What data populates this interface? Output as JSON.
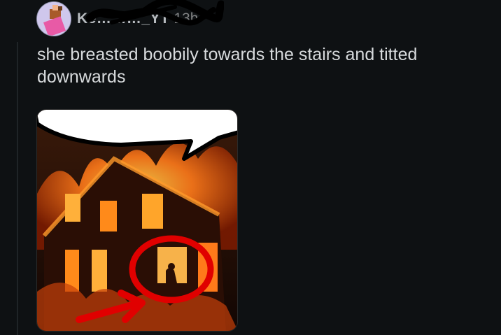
{
  "post": {
    "username": "Ke………_YT",
    "timestamp": "13h",
    "body": "she breasted boobily towards the stairs and titted downwards"
  },
  "media": {
    "alt": ""
  },
  "colors": {
    "background": "#0e1113",
    "text": "#d7dadc",
    "muted": "#818384",
    "fire": "#ff7a1a",
    "circle": "#e00000"
  },
  "icons": {
    "avatar": "user-avatar-icon"
  }
}
